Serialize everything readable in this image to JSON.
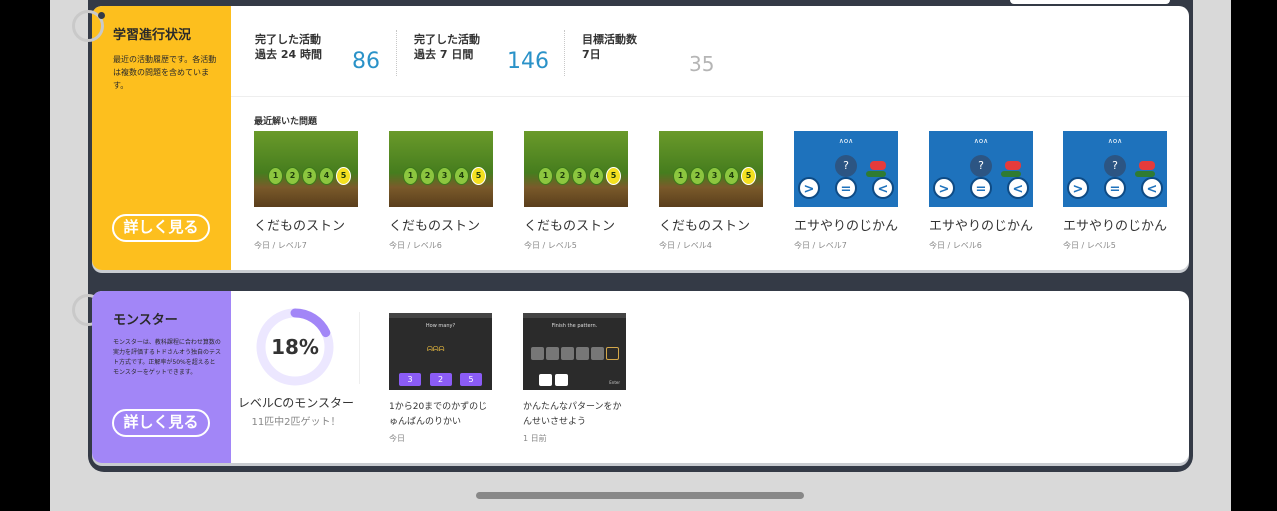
{
  "progress_card": {
    "title": "学習進行状況",
    "description": "最近の活動履歴です。各活動は複数の問題を含めています。",
    "more_label": "詳しく見る",
    "stats": [
      {
        "label_line1": "完了した活動",
        "label_line2": "過去 24 時間",
        "value": "86"
      },
      {
        "label_line1": "完了した活動",
        "label_line2": "過去 7 日間",
        "value": "146"
      },
      {
        "label_line1": "目標活動数",
        "label_line2": "7日",
        "value": "35"
      }
    ],
    "recent_label": "最近解いた問題",
    "recent_items": [
      {
        "name": "くだものストン",
        "sub": "今日 / レベル7",
        "stones": [
          "1",
          "2",
          "3",
          "4",
          "5"
        ]
      },
      {
        "name": "くだものストン",
        "sub": "今日 / レベル6",
        "stones": [
          "1",
          "2",
          "3",
          "4",
          "5"
        ]
      },
      {
        "name": "くだものストン",
        "sub": "今日 / レベル5",
        "stones": [
          "1",
          "2",
          "3",
          "4",
          "5"
        ]
      },
      {
        "name": "くだものストン",
        "sub": "今日 / レベル4",
        "stones": [
          "1",
          "2",
          "3",
          "4",
          "5"
        ]
      },
      {
        "name": "エサやりのじかん",
        "sub": "今日 / レベル7",
        "q": "?",
        "buttons": [
          ">",
          "=",
          "<"
        ]
      },
      {
        "name": "エサやりのじかん",
        "sub": "今日 / レベル6",
        "q": "?",
        "buttons": [
          ">",
          "=",
          "<"
        ]
      },
      {
        "name": "エサやりのじかん",
        "sub": "今日 / レベル5",
        "q": "?",
        "buttons": [
          ">",
          "=",
          "<"
        ]
      }
    ]
  },
  "monster_card": {
    "title": "モンスター",
    "description": "モンスターは、教科課程に合わせ算数の実力を評価するトドさんオう独自のテスト方式です。正解率が50%を超えるとモンスターをゲットできます。",
    "more_label": "詳しく見る",
    "progress_percent": 18,
    "progress_label": "18%",
    "level_name": "レベルCのモンスター",
    "level_sub": "11匹中2匹ゲット！",
    "items": [
      {
        "title": "1から20までのかずのじゅんばんのりかい",
        "sub": "今日",
        "screen_text": "How many?",
        "answers": [
          "3",
          "2",
          "5"
        ]
      },
      {
        "title": "かんたんなパターンをかんせいさせよう",
        "sub": "1 日前",
        "screen_text": "Finish the pattern.",
        "enter_label": "Enter"
      }
    ]
  },
  "colors": {
    "progress_accent": "#fdbf1e",
    "monster_accent": "#a286f7",
    "stat_value": "#2a92c8",
    "donut_track": "#ece7ff",
    "donut_fill": "#a286f7"
  }
}
